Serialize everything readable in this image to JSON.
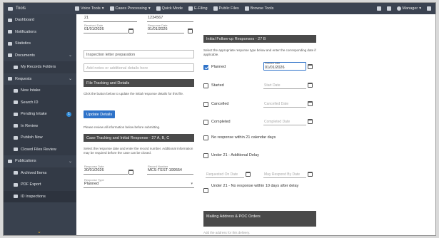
{
  "topbar": {
    "app_name": "Tools",
    "menu": [
      {
        "label": "Voice Tools",
        "has_dropdown": true
      },
      {
        "label": "Cases Processing",
        "has_dropdown": true
      },
      {
        "label": "Quick Mode",
        "has_dropdown": false
      },
      {
        "label": "E-Filing",
        "has_dropdown": false
      },
      {
        "label": "Public Files",
        "has_dropdown": false
      },
      {
        "label": "Browse Tools",
        "has_dropdown": false
      }
    ],
    "user_name": "Manager"
  },
  "sidebar": {
    "items": [
      {
        "label": "Dashboard",
        "icon": "dashboard-icon",
        "sub": false,
        "chevron": false
      },
      {
        "label": "Notifications",
        "icon": "bell-icon",
        "sub": false,
        "chevron": false
      },
      {
        "label": "Statistics",
        "icon": "chart-icon",
        "sub": false,
        "chevron": false
      },
      {
        "label": "Documents",
        "icon": "document-icon",
        "sub": false,
        "chevron": true
      },
      {
        "label": "My Records Folders",
        "icon": "folder-icon",
        "sub": true,
        "chevron": false
      },
      {
        "label": "Requests",
        "icon": "request-icon",
        "sub": false,
        "chevron": true
      },
      {
        "label": "New Intake",
        "icon": "inbox-icon",
        "sub": true,
        "chevron": false
      },
      {
        "label": "Search ID",
        "icon": "search-icon",
        "sub": true,
        "chevron": false
      },
      {
        "label": "Pending Intake",
        "icon": "clock-icon",
        "sub": true,
        "chevron": false,
        "badge": "1"
      },
      {
        "label": "In Review",
        "icon": "review-icon",
        "sub": true,
        "chevron": false
      },
      {
        "label": "Publish Now",
        "icon": "publish-icon",
        "sub": true,
        "chevron": false
      },
      {
        "label": "Closed Files Review",
        "icon": "archive-icon",
        "sub": true,
        "chevron": false
      },
      {
        "label": "Publications",
        "icon": "book-icon",
        "sub": false,
        "chevron": true
      },
      {
        "label": "Archived Items",
        "icon": "box-icon",
        "sub": true,
        "chevron": false
      },
      {
        "label": "PDF Export",
        "icon": "pdf-icon",
        "sub": true,
        "chevron": false
      },
      {
        "label": "ID Inspections",
        "icon": "id-icon",
        "sub": true,
        "chevron": false
      }
    ]
  },
  "left": {
    "top_left_value": "21",
    "top_right_value": "1234567",
    "date_received": {
      "label": "Received Date",
      "value": "01/01/2026"
    },
    "date_response": {
      "label": "Response Date",
      "value": "01/01/2026"
    },
    "description_value": "Inspection letter preparation",
    "notes_placeholder": "Add notes or additional details here",
    "section1_title": "File Tracking and Details",
    "section1_text": "Click the button below to update the initial response details for this file.",
    "update_button": "Update Details",
    "note_line": "Please review all information below before submitting.",
    "section2_title": "Case Tracking and Initial Response - 27 A, B, C",
    "section2_text": "Select the response date and enter the record number. Additional information may be required before the case can be closed.",
    "response_date": {
      "label": "Response Date",
      "value": "30/01/2026"
    },
    "record_number": {
      "label": "Record Number",
      "value": "MCS-TEST-199554"
    },
    "status_select": {
      "label": "Response Type",
      "value": "Planned"
    }
  },
  "right": {
    "section_title": "Initial Follow-up Responses - 27 B",
    "intro_text": "Select the appropriate response type below and enter the corresponding date if applicable.",
    "rows": [
      {
        "label": "Planned",
        "checked": true,
        "date_label": "Planned Date",
        "date_value": "01/01/2026",
        "date_placeholder": ""
      },
      {
        "label": "Started",
        "checked": false,
        "date_label": "",
        "date_value": "",
        "date_placeholder": "Start Date"
      },
      {
        "label": "Cancelled",
        "checked": false,
        "date_label": "",
        "date_value": "",
        "date_placeholder": "Cancelled Date"
      },
      {
        "label": "Completed",
        "checked": false,
        "date_label": "",
        "date_value": "",
        "date_placeholder": "Completed Date"
      }
    ],
    "chk_no_response": "No response within 21 calendar days",
    "chk_under21": "Under 21 - Additional Delay",
    "delay_start_placeholder": "Requested On Date",
    "delay_end_placeholder": "May Respond By Date",
    "chk_under21_no_response": "Under 21 - No response within 10 days after delay",
    "mailing_title": "Mailing Address & POC Orders",
    "mailing_text": "Add the address for this delivery."
  }
}
